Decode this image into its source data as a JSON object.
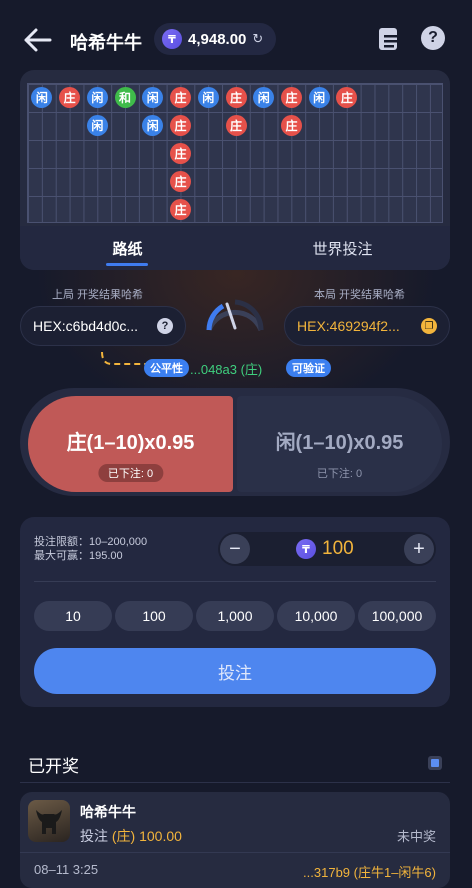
{
  "header": {
    "title": "哈希牛牛",
    "balance": "4,948.00",
    "coin_symbol": "₸"
  },
  "roadmap": {
    "beads": [
      {
        "label": "闲",
        "type": "p",
        "col": 0,
        "row": 0
      },
      {
        "label": "庄",
        "type": "b",
        "col": 1,
        "row": 0
      },
      {
        "label": "闲",
        "type": "p",
        "col": 2,
        "row": 0
      },
      {
        "label": "和",
        "type": "t",
        "col": 3,
        "row": 0
      },
      {
        "label": "闲",
        "type": "p",
        "col": 4,
        "row": 0
      },
      {
        "label": "庄",
        "type": "b",
        "col": 5,
        "row": 0
      },
      {
        "label": "闲",
        "type": "p",
        "col": 6,
        "row": 0
      },
      {
        "label": "庄",
        "type": "b",
        "col": 7,
        "row": 0
      },
      {
        "label": "闲",
        "type": "p",
        "col": 8,
        "row": 0
      },
      {
        "label": "庄",
        "type": "b",
        "col": 9,
        "row": 0
      },
      {
        "label": "闲",
        "type": "p",
        "col": 10,
        "row": 0
      },
      {
        "label": "庄",
        "type": "b",
        "col": 11,
        "row": 0
      },
      {
        "label": "闲",
        "type": "p",
        "col": 2,
        "row": 1
      },
      {
        "label": "闲",
        "type": "p",
        "col": 4,
        "row": 1
      },
      {
        "label": "庄",
        "type": "b",
        "col": 5,
        "row": 1
      },
      {
        "label": "庄",
        "type": "b",
        "col": 7,
        "row": 1
      },
      {
        "label": "庄",
        "type": "b",
        "col": 9,
        "row": 1
      },
      {
        "label": "庄",
        "type": "b",
        "col": 5,
        "row": 2
      },
      {
        "label": "庄",
        "type": "b",
        "col": 5,
        "row": 3
      },
      {
        "label": "庄",
        "type": "b",
        "col": 5,
        "row": 4
      }
    ],
    "tabs": [
      "路纸",
      "世界投注"
    ]
  },
  "hash": {
    "prev_label": "上局 开奖结果哈希",
    "prev_value": "HEX:c6bd4d0c...",
    "curr_label": "本局 开奖结果哈希",
    "curr_value": "HEX:469294f2...",
    "fair_badge": "公平性",
    "fair_hash": "...048a3 (庄)",
    "verify_badge": "可验证"
  },
  "bet": {
    "banker_label": "庄(1–10)x0.95",
    "banker_placed": "已下注: 0",
    "player_label": "闲(1–10)x0.95",
    "player_placed": "已下注: 0"
  },
  "amount": {
    "limit_line": "投注限额：10–200,000",
    "max_win_line": "最大可赢：195.00",
    "minus": "−",
    "plus": "+",
    "stake": "100",
    "chips": [
      "10",
      "100",
      "1,000",
      "10,000",
      "100,000"
    ],
    "submit": "投注"
  },
  "results": {
    "title": "已开奖",
    "game_name": "哈希牛牛",
    "bet_prefix": "投注",
    "bet_side": "(庄)",
    "bet_amount": "100.00",
    "status": "未中奖",
    "time": "08–11 3:25",
    "hash": "...317b9 (庄牛1–闲牛6)"
  },
  "colors": {
    "banker": "#e6514a",
    "player": "#3a82e8",
    "tie": "#3fbb4a",
    "accent": "#4e86ef",
    "gold": "#f2b43c"
  }
}
